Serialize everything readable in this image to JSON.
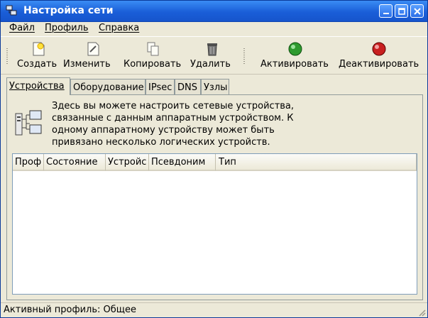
{
  "window": {
    "title": "Настройка сети"
  },
  "menu": [
    {
      "label": "Файл"
    },
    {
      "label": "Профиль"
    },
    {
      "label": "Справка"
    }
  ],
  "toolbar": {
    "create": "Создать",
    "edit": "Изменить",
    "copy": "Копировать",
    "delete": "Удалить",
    "activate": "Активировать",
    "deactivate": "Деактивировать"
  },
  "tabs": [
    {
      "label": "Устройства"
    },
    {
      "label": "Оборудование"
    },
    {
      "label": "IPsec"
    },
    {
      "label": "DNS"
    },
    {
      "label": "Узлы"
    }
  ],
  "devices": {
    "description": [
      "Здесь вы можете настроить сетевые устройства,",
      "связанные с данным аппаратным устройством. К",
      "одному аппаратному устройству может быть",
      "привязано несколько логических устройств."
    ],
    "columns": [
      "Проф",
      "Состояние",
      "Устройс",
      "Псевдоним",
      "Тип"
    ]
  },
  "status": {
    "text": "Активный профиль: Общее"
  },
  "colors": {
    "titlebar": "#1a5ed8",
    "activate_led": "#2e9a2e",
    "deactivate_led": "#c82020"
  }
}
